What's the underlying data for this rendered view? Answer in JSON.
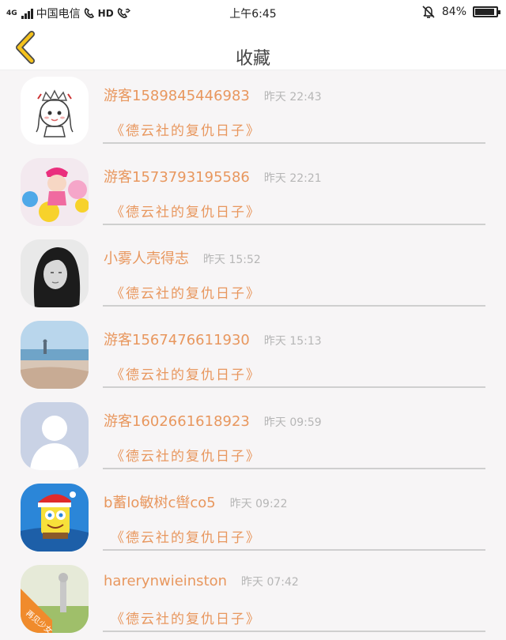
{
  "status_bar": {
    "network": "4G",
    "carrier": "中国电信",
    "hd": "HD",
    "time": "上午6:45",
    "battery": "84%",
    "battery_level": 0.84
  },
  "nav": {
    "back_icon": "chevron-left-icon",
    "title": "收藏"
  },
  "favorites": [
    {
      "user": "游客1589845446983",
      "time": "昨天 22:43",
      "title": "《德云社的复仇日子》"
    },
    {
      "user": "游客1573793195586",
      "time": "昨天 22:21",
      "title": "《德云社的复仇日子》"
    },
    {
      "user": "小雾人壳得志",
      "time": "昨天 15:52",
      "title": "《德云社的复仇日子》"
    },
    {
      "user": "游客1567476611930",
      "time": "昨天 15:13",
      "title": "《德云社的复仇日子》"
    },
    {
      "user": "游客1602661618923",
      "time": "昨天 09:59",
      "title": "《德云社的复仇日子》"
    },
    {
      "user": "b蓄lo敏树c辔co5",
      "time": "昨天 09:22",
      "title": "《德云社的复仇日子》"
    },
    {
      "user": "harerynwieinston",
      "time": "昨天 07:42",
      "title": "《德云社的复仇日子》"
    }
  ],
  "avatar_7_text": "再见少女",
  "colors": {
    "accent": "#e8975e",
    "time_gray": "#b6b6b6",
    "background": "#f7f5f6"
  }
}
